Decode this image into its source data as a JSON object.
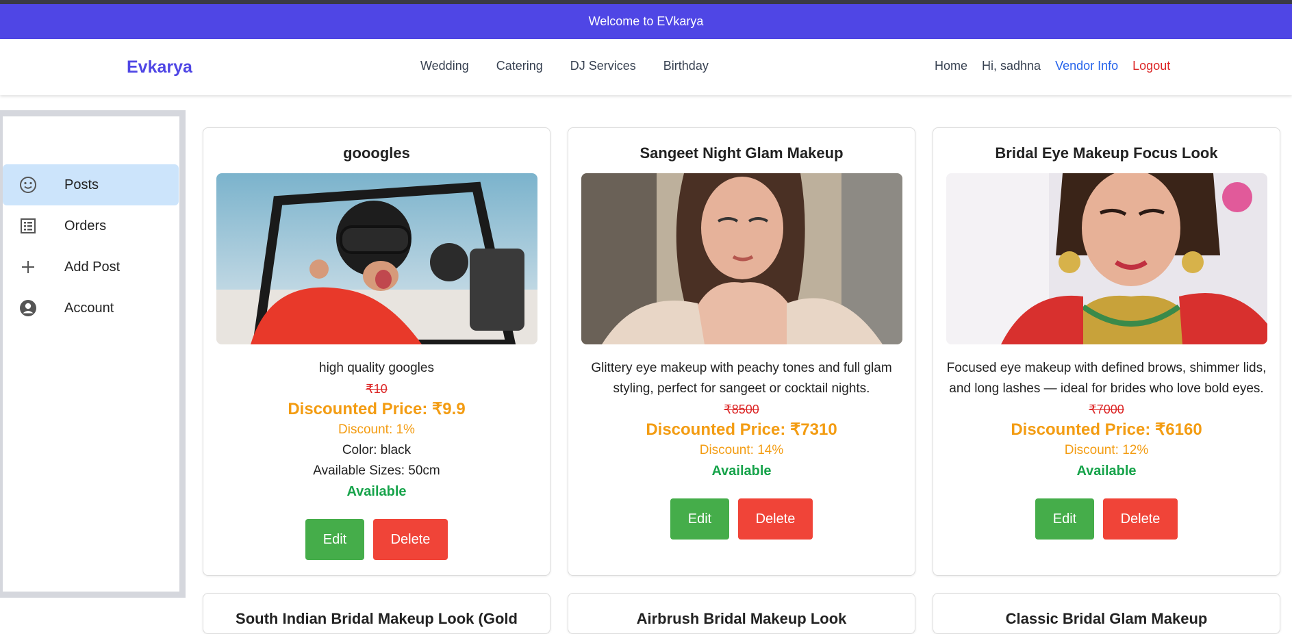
{
  "banner": {
    "text": "Welcome to EVkarya"
  },
  "navbar": {
    "brand": "Evkarya",
    "categories": [
      "Wedding",
      "Catering",
      "DJ Services",
      "Birthday"
    ],
    "home": "Home",
    "greeting": "Hi, sadhna",
    "vendor_info": "Vendor Info",
    "logout": "Logout"
  },
  "sidebar": {
    "items": [
      {
        "label": "Posts",
        "icon": "smiley-icon",
        "active": true
      },
      {
        "label": "Orders",
        "icon": "list-icon"
      },
      {
        "label": "Add Post",
        "icon": "plus-icon"
      },
      {
        "label": "Account",
        "icon": "user-circle-icon"
      }
    ]
  },
  "cards": [
    {
      "title": "gooogles",
      "image": "person wearing goggles and helmet in off-road buggy",
      "description": "high quality googles",
      "original_price": "₹10",
      "discounted_price": "Discounted Price: ₹9.9",
      "discount": "Discount: 1%",
      "color": "Color: black",
      "sizes": "Available Sizes: 50cm",
      "status": "Available",
      "edit_label": "Edit",
      "delete_label": "Delete"
    },
    {
      "title": "Sangeet Night Glam Makeup",
      "image": "woman with glam eye makeup wearing feather top",
      "description": "Glittery eye makeup with peachy tones and full glam styling, perfect for sangeet or cocktail nights.",
      "original_price": "₹8500",
      "discounted_price": "Discounted Price: ₹7310",
      "discount": "Discount: 14%",
      "status": "Available",
      "edit_label": "Edit",
      "delete_label": "Delete"
    },
    {
      "title": "Bridal Eye Makeup Focus Look",
      "image": "bride with gold jewellery and red outfit",
      "description": "Focused eye makeup with defined brows, shimmer lids, and long lashes — ideal for brides who love bold eyes.",
      "original_price": "₹7000",
      "discounted_price": "Discounted Price: ₹6160",
      "discount": "Discount: 12%",
      "status": "Available",
      "edit_label": "Edit",
      "delete_label": "Delete"
    }
  ],
  "more_cards": [
    {
      "title": "South Indian Bridal Makeup Look (Gold"
    },
    {
      "title": "Airbrush Bridal Makeup Look"
    },
    {
      "title": "Classic Bridal Glam Makeup"
    }
  ]
}
